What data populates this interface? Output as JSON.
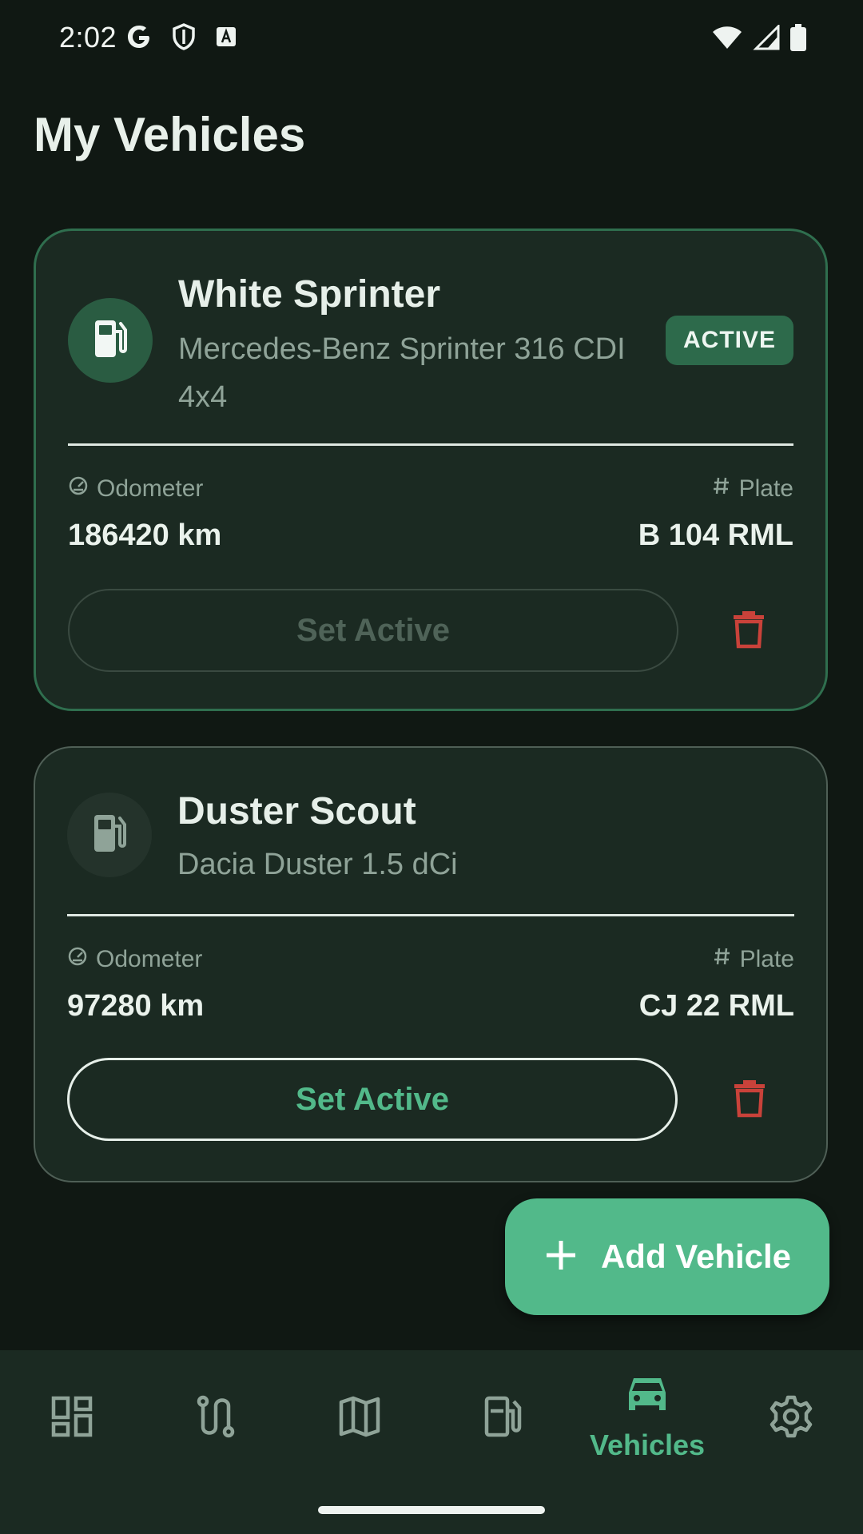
{
  "status_bar": {
    "time": "2:02"
  },
  "page": {
    "title": "My Vehicles"
  },
  "vehicles": [
    {
      "name": "White Sprinter",
      "model": "Mercedes-Benz Sprinter 316 CDI 4x4",
      "badge": "ACTIVE",
      "odometer_label": "Odometer",
      "odometer_value": "186420 km",
      "plate_label": "Plate",
      "plate_value": "B 104 RML",
      "set_active_label": "Set Active"
    },
    {
      "name": "Duster Scout",
      "model": "Dacia Duster 1.5 dCi",
      "odometer_label": "Odometer",
      "odometer_value": "97280 km",
      "plate_label": "Plate",
      "plate_value": "CJ 22 RML",
      "set_active_label": "Set Active"
    }
  ],
  "fab": {
    "label": "Add Vehicle",
    "icon": "plus-icon"
  },
  "nav": {
    "items": [
      {
        "icon": "dashboard-icon",
        "label": ""
      },
      {
        "icon": "route-icon",
        "label": ""
      },
      {
        "icon": "map-icon",
        "label": ""
      },
      {
        "icon": "fuel-icon",
        "label": ""
      },
      {
        "icon": "car-icon",
        "label": "Vehicles",
        "selected": true
      },
      {
        "icon": "settings-icon",
        "label": ""
      }
    ]
  },
  "colors": {
    "background": "#101813",
    "card": "#1b2a22",
    "accent": "#52b98a",
    "active_border": "#2f6e4e",
    "delete": "#c9423a"
  }
}
